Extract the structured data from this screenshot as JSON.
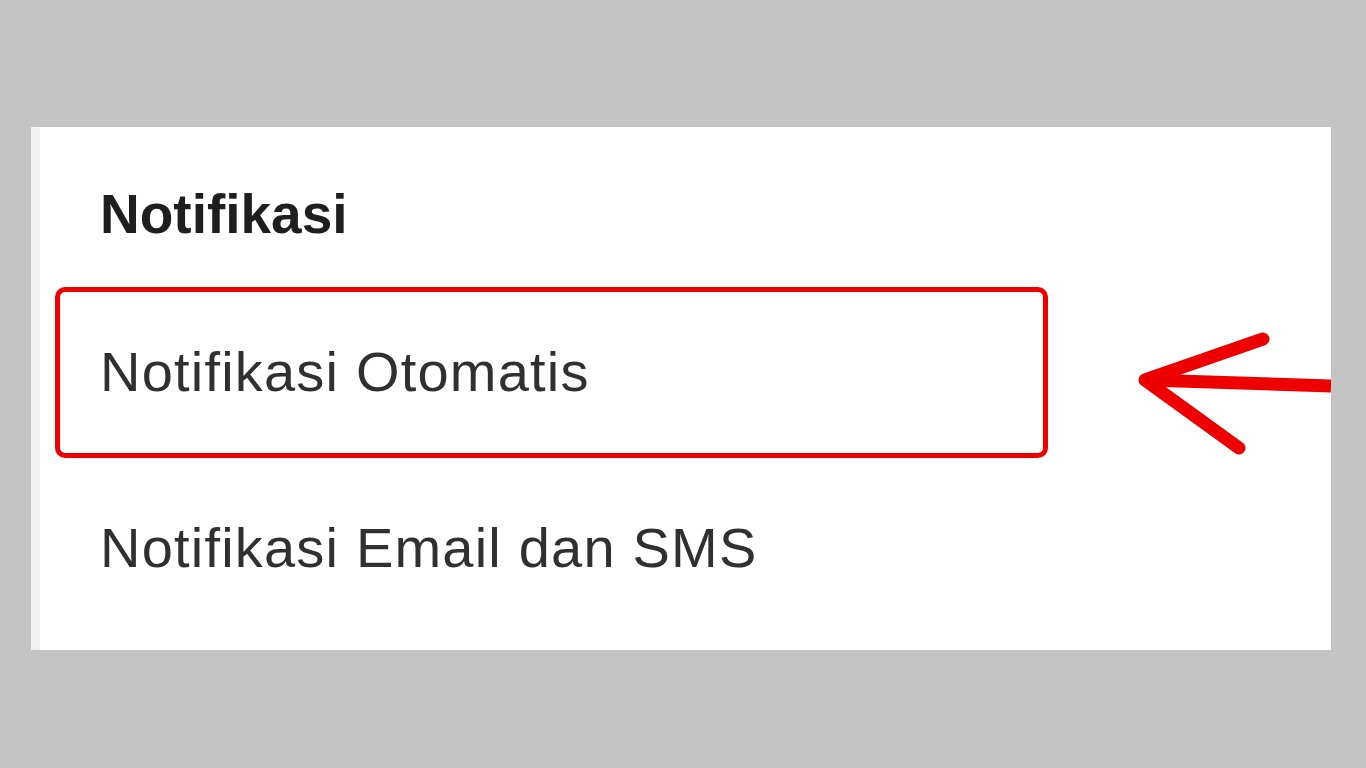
{
  "section": {
    "title": "Notifikasi",
    "items": [
      {
        "label": "Notifikasi Otomatis",
        "highlighted": true
      },
      {
        "label": "Notifikasi Email dan SMS",
        "highlighted": false
      }
    ]
  }
}
